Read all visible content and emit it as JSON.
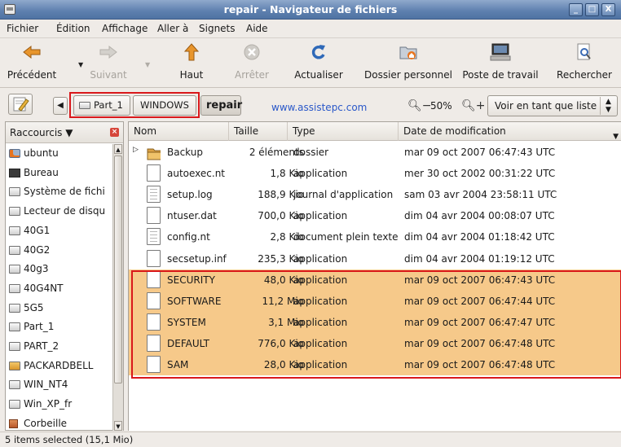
{
  "window": {
    "title": "repair - Navigateur de fichiers",
    "buttons": [
      "_",
      "□",
      "X"
    ]
  },
  "menu": [
    "Fichier",
    "Édition",
    "Affichage",
    "Aller à",
    "Signets",
    "Aide"
  ],
  "toolbar": {
    "back": "Précédent",
    "forward": "Suivant",
    "up": "Haut",
    "stop": "Arrêter",
    "reload": "Actualiser",
    "home": "Dossier personnel",
    "computer": "Poste de travail",
    "search": "Rechercher"
  },
  "location": {
    "crumbs": [
      "Part_1",
      "WINDOWS",
      "repair"
    ],
    "watermark": "www.assistepc.com",
    "zoom": "50%",
    "view": "Voir en tant que liste"
  },
  "sidebar": {
    "header": "Raccourcis",
    "items": [
      {
        "label": "ubuntu",
        "icon": "home-folder-icon"
      },
      {
        "label": "Bureau",
        "icon": "desktop-icon"
      },
      {
        "label": "Système de fichi",
        "icon": "drive-icon"
      },
      {
        "label": "Lecteur de disqu",
        "icon": "drive-icon"
      },
      {
        "label": "40G1",
        "icon": "drive-icon"
      },
      {
        "label": "40G2",
        "icon": "drive-icon"
      },
      {
        "label": "40g3",
        "icon": "drive-icon"
      },
      {
        "label": "40G4NT",
        "icon": "drive-icon"
      },
      {
        "label": "5G5",
        "icon": "drive-icon"
      },
      {
        "label": "Part_1",
        "icon": "drive-icon"
      },
      {
        "label": "PART_2",
        "icon": "drive-icon"
      },
      {
        "label": "PACKARDBELL",
        "icon": "drive-locked-icon"
      },
      {
        "label": "WIN_NT4",
        "icon": "drive-icon"
      },
      {
        "label": "Win_XP_fr",
        "icon": "drive-icon"
      },
      {
        "label": "Corbeille",
        "icon": "trash-icon"
      }
    ]
  },
  "columns": [
    "Nom",
    "Taille",
    "Type",
    "Date de modification"
  ],
  "files": [
    {
      "name": "Backup",
      "size": "2 éléments",
      "type": "dossier",
      "date": "mar 09 oct 2007 06:47:43 UTC",
      "kind": "folder",
      "selected": false
    },
    {
      "name": "autoexec.nt",
      "size": "1,8 Kio",
      "type": "application",
      "date": "mer 30 oct 2002 00:31:22 UTC",
      "kind": "file",
      "selected": false
    },
    {
      "name": "setup.log",
      "size": "188,9 Kio",
      "type": "journal d'application",
      "date": "sam 03 avr 2004 23:58:11 UTC",
      "kind": "text",
      "selected": false
    },
    {
      "name": "ntuser.dat",
      "size": "700,0 Kio",
      "type": "application",
      "date": "dim 04 avr 2004 00:08:07 UTC",
      "kind": "file",
      "selected": false
    },
    {
      "name": "config.nt",
      "size": "2,8 Kio",
      "type": "document plein texte",
      "date": "dim 04 avr 2004 01:18:42 UTC",
      "kind": "text",
      "selected": false
    },
    {
      "name": "secsetup.inf",
      "size": "235,3 Kio",
      "type": "application",
      "date": "dim 04 avr 2004 01:19:12 UTC",
      "kind": "file",
      "selected": false
    },
    {
      "name": "SECURITY",
      "size": "48,0 Kio",
      "type": "application",
      "date": "mar 09 oct 2007 06:47:43 UTC",
      "kind": "file",
      "selected": true
    },
    {
      "name": "SOFTWARE",
      "size": "11,2 Mio",
      "type": "application",
      "date": "mar 09 oct 2007 06:47:44 UTC",
      "kind": "file",
      "selected": true
    },
    {
      "name": "SYSTEM",
      "size": "3,1 Mio",
      "type": "application",
      "date": "mar 09 oct 2007 06:47:47 UTC",
      "kind": "file",
      "selected": true
    },
    {
      "name": "DEFAULT",
      "size": "776,0 Kio",
      "type": "application",
      "date": "mar 09 oct 2007 06:47:48 UTC",
      "kind": "file",
      "selected": true
    },
    {
      "name": "SAM",
      "size": "28,0 Kio",
      "type": "application",
      "date": "mar 09 oct 2007 06:47:48 UTC",
      "kind": "file",
      "selected": true
    }
  ],
  "status": "5 items selected (15,1 Mio)",
  "colors": {
    "selection": "#f6c98a",
    "highlight_box": "#d9181b",
    "titlebar": "#5d7fae",
    "watermark": "#2a58c9"
  }
}
